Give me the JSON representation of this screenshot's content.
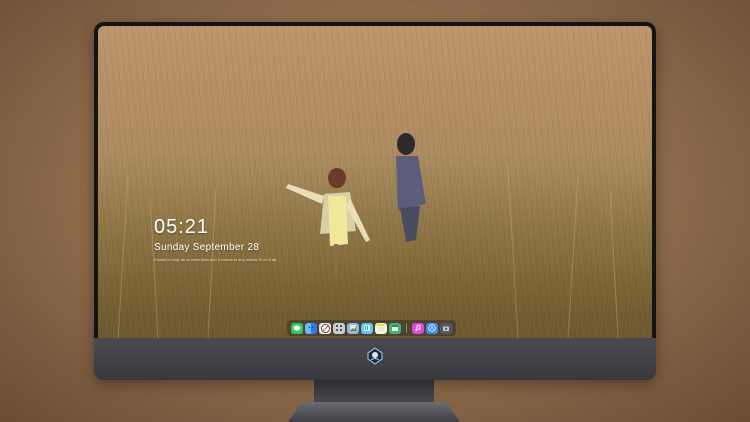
{
  "screen": {
    "lockscreen": {
      "time": "05:21",
      "date": "Sunday September  28",
      "lyric": "Known to long as us even miss you it comes to any worlds I'll do it all..."
    }
  },
  "dock": {
    "items": [
      {
        "icon": "messages-icon",
        "color": "#34c759"
      },
      {
        "icon": "finder-icon",
        "color": "#2b7de9"
      },
      {
        "icon": "safari-icon",
        "color": "#e8e8ea"
      },
      {
        "icon": "launchpad-icon",
        "color": "#c9ccd2"
      },
      {
        "icon": "preview-icon",
        "color": "#8fb8d8"
      },
      {
        "icon": "photos-icon",
        "color": "#5ac8fa"
      },
      {
        "icon": "notes-icon",
        "color": "#f7d64a"
      },
      {
        "icon": "calendar-icon",
        "color": "#4caf78"
      },
      {
        "icon": "itunes-icon",
        "color": "#e04ad8"
      },
      {
        "icon": "app-store-icon",
        "color": "#3a8ef0"
      },
      {
        "icon": "screenshot-icon",
        "color": "#555a62"
      }
    ]
  },
  "colors": {
    "background": "#94714f",
    "bezel": "#141416",
    "chin": "#434247"
  }
}
